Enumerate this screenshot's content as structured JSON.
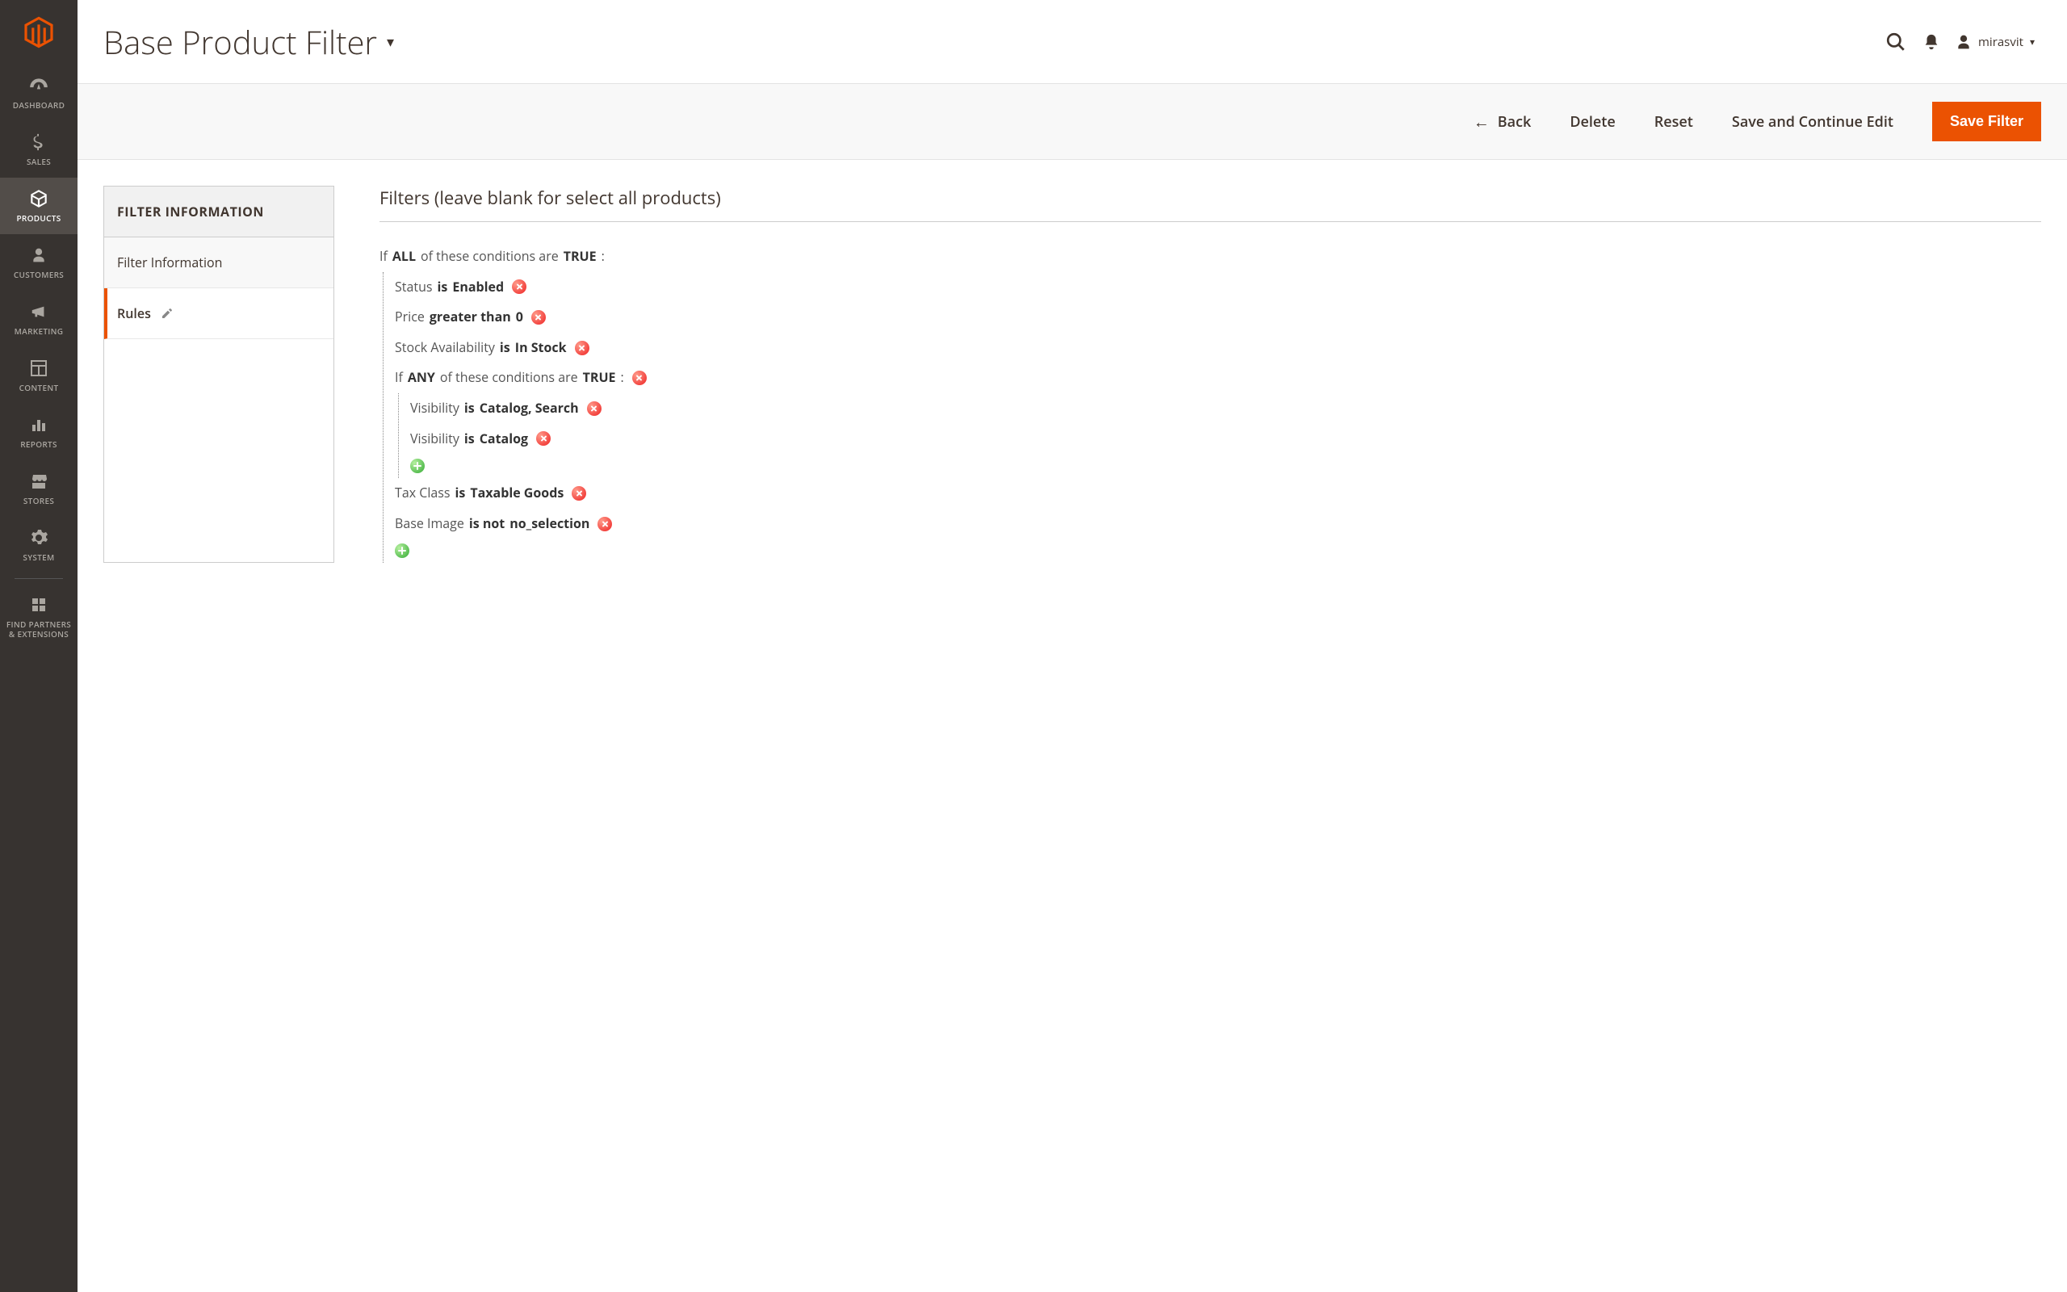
{
  "colors": {
    "accent": "#eb5202",
    "sidebar_bg": "#373330"
  },
  "header": {
    "page_title": "Base Product Filter",
    "user_name": "mirasvit"
  },
  "sidebar": {
    "items": [
      {
        "id": "dashboard",
        "label": "DASHBOARD",
        "icon": "gauge-icon"
      },
      {
        "id": "sales",
        "label": "SALES",
        "icon": "dollar-icon"
      },
      {
        "id": "products",
        "label": "PRODUCTS",
        "icon": "box-icon",
        "active": true
      },
      {
        "id": "customers",
        "label": "CUSTOMERS",
        "icon": "person-icon"
      },
      {
        "id": "marketing",
        "label": "MARKETING",
        "icon": "megaphone-icon"
      },
      {
        "id": "content",
        "label": "CONTENT",
        "icon": "layout-icon"
      },
      {
        "id": "reports",
        "label": "REPORTS",
        "icon": "bars-icon"
      },
      {
        "id": "stores",
        "label": "STORES",
        "icon": "storefront-icon"
      },
      {
        "id": "system",
        "label": "SYSTEM",
        "icon": "gear-icon"
      },
      {
        "id": "partners",
        "label": "FIND PARTNERS\n& EXTENSIONS",
        "icon": "blocks-icon"
      }
    ]
  },
  "actions": {
    "back": "Back",
    "delete": "Delete",
    "reset": "Reset",
    "save_continue": "Save and Continue Edit",
    "save": "Save Filter"
  },
  "sidepanel": {
    "heading": "FILTER INFORMATION",
    "tabs": [
      {
        "id": "filter_info",
        "label": "Filter Information"
      },
      {
        "id": "rules",
        "label": "Rules",
        "active": true,
        "editing": true
      }
    ]
  },
  "rules_section": {
    "title": "Filters (leave blank for select all products)",
    "root": {
      "prefix_if": "If",
      "aggregator": "ALL",
      "middle": "of these conditions are",
      "value": "TRUE",
      "suffix": ":"
    },
    "conditions": [
      {
        "attr": "Status",
        "op": "is",
        "val": "Enabled"
      },
      {
        "attr": "Price",
        "op": "greater than",
        "val": "0"
      },
      {
        "attr": "Stock Availability",
        "op": "is",
        "val": "In Stock"
      },
      {
        "combine": true,
        "prefix_if": "If",
        "aggregator": "ANY",
        "middle": "of these conditions are",
        "value": "TRUE",
        "suffix": ":",
        "children": [
          {
            "attr": "Visibility",
            "op": "is",
            "val": "Catalog, Search"
          },
          {
            "attr": "Visibility",
            "op": "is",
            "val": "Catalog"
          }
        ]
      },
      {
        "attr": "Tax Class",
        "op": "is",
        "val": "Taxable Goods"
      },
      {
        "attr": "Base Image",
        "op": "is not",
        "val": "no_selection"
      }
    ]
  }
}
